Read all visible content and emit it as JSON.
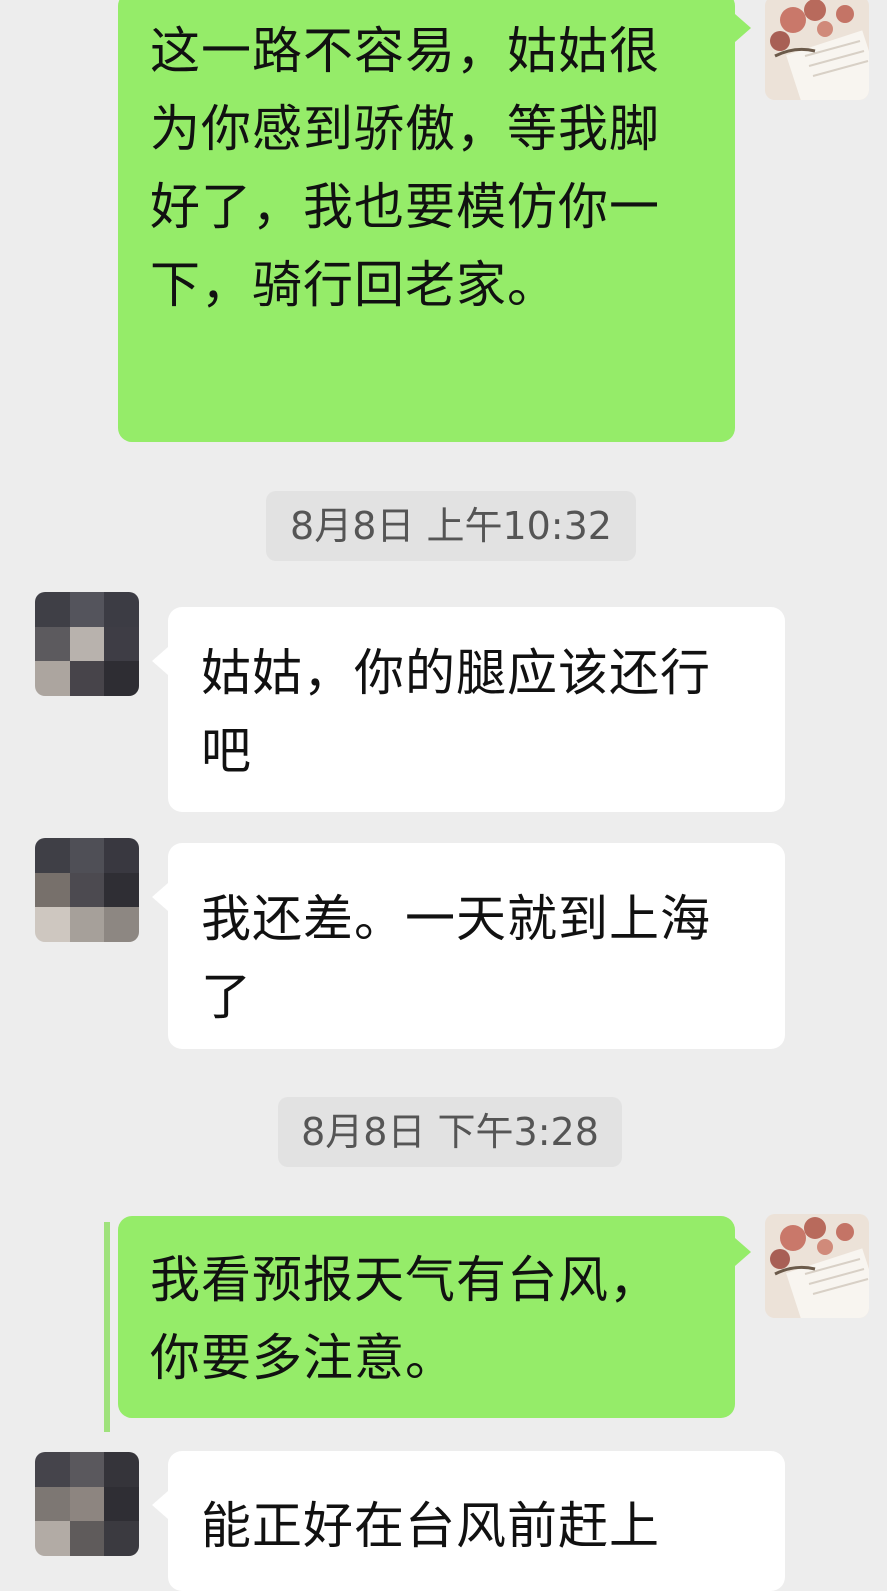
{
  "messages": [
    {
      "side": "self",
      "text": "这一路不容易，姑姑很为你感到骄傲，等我脚好了，我也要模仿你一下，骑行回老家。"
    },
    {
      "side": "timestamp",
      "text": "8月8日 上午10:32"
    },
    {
      "side": "other",
      "text": "姑姑，你的腿应该还行吧"
    },
    {
      "side": "other",
      "text": "我还差。一天就到上海了"
    },
    {
      "side": "timestamp",
      "text": "8月8日 下午3:28"
    },
    {
      "side": "self",
      "text": "我看预报天气有台风，你要多注意。"
    },
    {
      "side": "other",
      "text": "能正好在台风前赶上"
    }
  ],
  "colors": {
    "background": "#ededed",
    "self_bubble": "#95ec69",
    "other_bubble": "#ffffff",
    "timestamp_bg": "#e2e2e2"
  },
  "icons": {
    "self_avatar": "flowers-book-photo",
    "other_avatar": "pixelated-photo"
  }
}
